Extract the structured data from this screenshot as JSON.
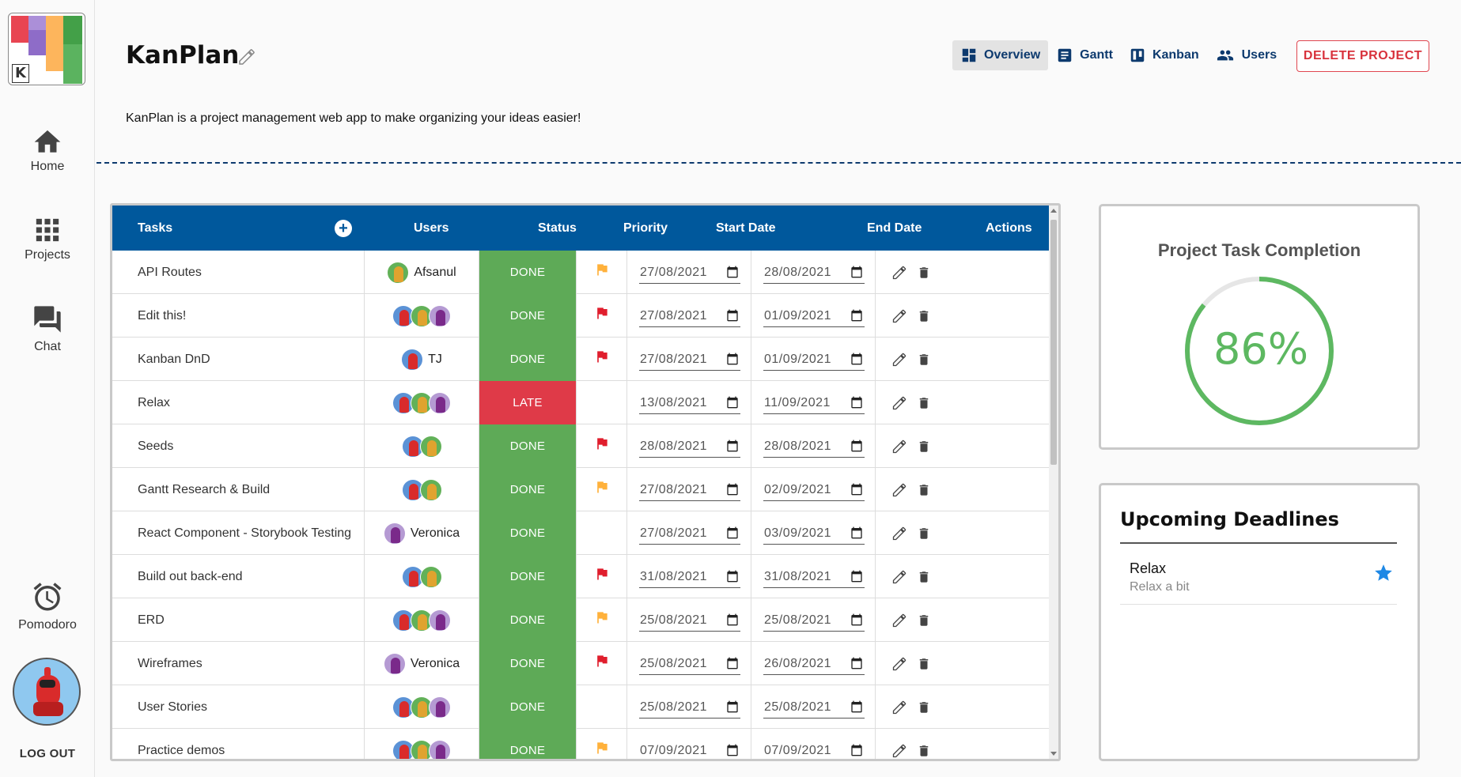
{
  "sidebar": {
    "logo_letter": "K",
    "items": [
      {
        "label": "Home",
        "icon": "home-icon"
      },
      {
        "label": "Projects",
        "icon": "grid-icon"
      },
      {
        "label": "Chat",
        "icon": "chat-icon"
      },
      {
        "label": "Pomodoro",
        "icon": "alarm-icon"
      }
    ],
    "logout": "LOG OUT"
  },
  "project": {
    "title": "KanPlan",
    "description": "KanPlan is a project management web app to make organizing your ideas easier!"
  },
  "topnav": {
    "overview": "Overview",
    "gantt": "Gantt",
    "kanban": "Kanban",
    "users": "Users",
    "delete": "DELETE PROJECT"
  },
  "colors": {
    "header_blue": "#00589c",
    "done_green": "#5eaa57",
    "late_red": "#df3a48",
    "accent_navy": "#0d3a6e",
    "progress_green": "#5db861",
    "flag_orange": "#ffb13b",
    "flag_red": "#e01e2d"
  },
  "table": {
    "headers": {
      "tasks": "Tasks",
      "users": "Users",
      "status": "Status",
      "priority": "Priority",
      "start": "Start Date",
      "end": "End Date",
      "actions": "Actions"
    },
    "rows": [
      {
        "task": "API Routes",
        "users": [
          "orange"
        ],
        "user_name": "Afsanul",
        "status": "DONE",
        "priority": "orange",
        "start": "27/08/2021",
        "end": "28/08/2021"
      },
      {
        "task": "Edit this!",
        "users": [
          "red",
          "orange",
          "purple"
        ],
        "user_name": "",
        "status": "DONE",
        "priority": "red",
        "start": "27/08/2021",
        "end": "01/09/2021"
      },
      {
        "task": "Kanban DnD",
        "users": [
          "red"
        ],
        "user_name": "TJ",
        "status": "DONE",
        "priority": "red",
        "start": "27/08/2021",
        "end": "01/09/2021"
      },
      {
        "task": "Relax",
        "users": [
          "red",
          "orange",
          "purple"
        ],
        "user_name": "",
        "status": "LATE",
        "priority": "none",
        "start": "13/08/2021",
        "end": "11/09/2021"
      },
      {
        "task": "Seeds",
        "users": [
          "red",
          "orange"
        ],
        "user_name": "",
        "status": "DONE",
        "priority": "red",
        "start": "28/08/2021",
        "end": "28/08/2021"
      },
      {
        "task": "Gantt Research & Build",
        "users": [
          "red",
          "orange"
        ],
        "user_name": "",
        "status": "DONE",
        "priority": "orange",
        "start": "27/08/2021",
        "end": "02/09/2021"
      },
      {
        "task": "React Component - Storybook Testing",
        "users": [
          "purple"
        ],
        "user_name": "Veronica",
        "status": "DONE",
        "priority": "none",
        "start": "27/08/2021",
        "end": "03/09/2021"
      },
      {
        "task": "Build out back-end",
        "users": [
          "red",
          "orange"
        ],
        "user_name": "",
        "status": "DONE",
        "priority": "red",
        "start": "31/08/2021",
        "end": "31/08/2021"
      },
      {
        "task": "ERD",
        "users": [
          "red",
          "orange",
          "purple"
        ],
        "user_name": "",
        "status": "DONE",
        "priority": "orange",
        "start": "25/08/2021",
        "end": "25/08/2021"
      },
      {
        "task": "Wireframes",
        "users": [
          "purple"
        ],
        "user_name": "Veronica",
        "status": "DONE",
        "priority": "red",
        "start": "25/08/2021",
        "end": "26/08/2021"
      },
      {
        "task": "User Stories",
        "users": [
          "red",
          "orange",
          "purple"
        ],
        "user_name": "",
        "status": "DONE",
        "priority": "none",
        "start": "25/08/2021",
        "end": "25/08/2021"
      },
      {
        "task": "Practice demos",
        "users": [
          "red",
          "orange",
          "purple"
        ],
        "user_name": "",
        "status": "DONE",
        "priority": "orange",
        "start": "07/09/2021",
        "end": "07/09/2021"
      }
    ]
  },
  "completion": {
    "title": "Project Task Completion",
    "percent_label": "86%",
    "percent_value": 86
  },
  "deadlines": {
    "title": "Upcoming Deadlines",
    "items": [
      {
        "title": "Relax",
        "subtitle": "Relax a bit"
      }
    ]
  }
}
